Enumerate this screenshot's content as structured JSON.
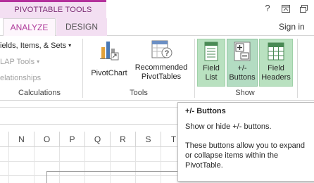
{
  "context_tab": {
    "title": "PIVOTTABLE TOOLS"
  },
  "window_controls": {
    "help": "?",
    "ribbon_display": "⊼",
    "restore": "⧉"
  },
  "tabs": [
    {
      "label": "ANALYZE",
      "active": true
    },
    {
      "label": "DESIGN",
      "active": false
    }
  ],
  "account": {
    "signin_label": "Sign in"
  },
  "ribbon": {
    "calculations": {
      "items": [
        {
          "label": "ields, Items, & Sets",
          "arrow": "▾",
          "enabled": true
        },
        {
          "label": "LAP Tools",
          "arrow": "▾",
          "enabled": false
        },
        {
          "label": "elationships",
          "enabled": false
        }
      ],
      "group_label": "Calculations"
    },
    "tools": {
      "pivotchart_label": "PivotChart",
      "recommended_line1": "Recommended",
      "recommended_line2": "PivotTables",
      "group_label": "Tools"
    },
    "show": {
      "field_list_line1": "Field",
      "field_list_line2": "List",
      "buttons_line1": "+/-",
      "buttons_line2": "Buttons",
      "field_headers_line1": "Field",
      "field_headers_line2": "Headers",
      "group_label": "Show"
    }
  },
  "columns": [
    "N",
    "O",
    "P",
    "Q",
    "R",
    "S",
    "T"
  ],
  "tooltip": {
    "title": "+/- Buttons",
    "summary": "Show or hide +/- buttons.",
    "desc_line1": "These buttons allow you to expand",
    "desc_line2": "or collapse items within the",
    "desc_line3": "PivotTable."
  },
  "colors": {
    "context_accent": "#b4309b",
    "context_fill": "#f3dff2",
    "show_toggle_fill": "#b9e1c0",
    "icon_green": "#4a8a55"
  }
}
